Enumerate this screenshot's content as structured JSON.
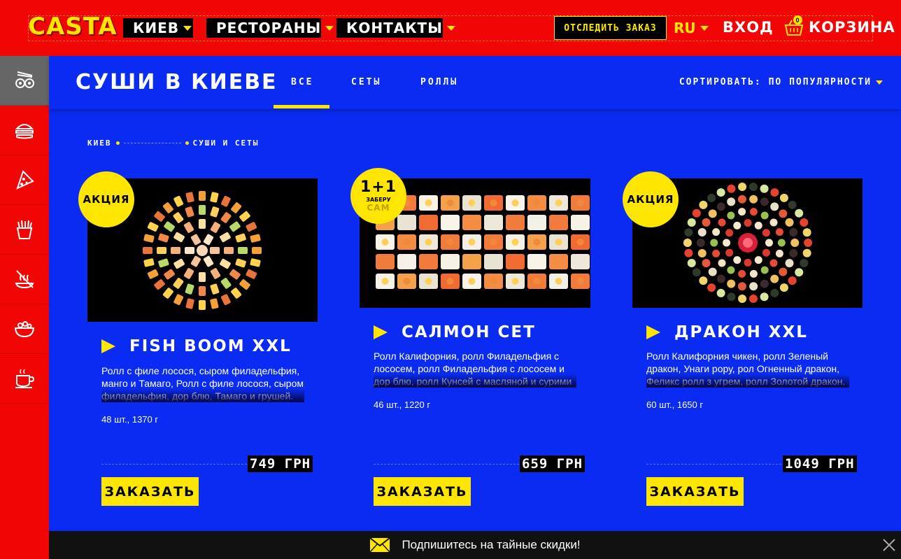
{
  "header": {
    "logo": "CASTA",
    "nav": [
      {
        "label": "КИЕВ"
      },
      {
        "label": "РЕСТОРАНЫ"
      },
      {
        "label": "КОНТАКТЫ"
      }
    ],
    "track_order": "ОТСЛЕДИТЬ ЗАКАЗ",
    "language": "RU",
    "login": "ВХОД",
    "cart_label": "КОРЗИНА",
    "cart_count": "0"
  },
  "sidebar": {
    "items": [
      {
        "icon": "sushi-icon",
        "active": true
      },
      {
        "icon": "burger-icon"
      },
      {
        "icon": "pizza-icon"
      },
      {
        "icon": "fries-icon"
      },
      {
        "icon": "hot-dish-icon"
      },
      {
        "icon": "salad-icon"
      },
      {
        "icon": "coffee-cup-icon"
      }
    ]
  },
  "subheader": {
    "title": "СУШИ В КИЕВЕ",
    "tabs": [
      {
        "label": "ВСЕ",
        "active": true
      },
      {
        "label": "СЕТЫ"
      },
      {
        "label": "РОЛЛЫ"
      }
    ],
    "sort_label": "СОРТИРОВАТЬ: ПО ПОПУЛЯРНОСТИ"
  },
  "breadcrumb": {
    "items": [
      "КИЕВ",
      "СУШИ И СЕТЫ"
    ]
  },
  "products": [
    {
      "badge": "АКЦИЯ",
      "title": "FISH BOOM XXL",
      "description": "Ролл с филе лосося, сыром филадельфия, манго и Тамаго, Ролл с филе лосося, сыром филадельфия, дор блю, Тамаго и грушей.",
      "weight": "48 шт., 1370 г",
      "price": "749 ГРН",
      "order": "ЗАКАЗАТЬ"
    },
    {
      "badge_top": "1+1",
      "badge_small": "ЗАБЕРУ",
      "badge_mid": "САМ",
      "title": "САЛМОН СЕТ",
      "description": "Ролл Калифорния, ролл Филадельфия с лососем, ролл Филадельфия с лососем и дор блю, ролл Кунсей с масляной и сурими",
      "weight": "46 шт., 1220 г",
      "price": "659 ГРН",
      "order": "ЗАКАЗАТЬ"
    },
    {
      "badge": "АКЦИЯ",
      "title": "ДРАКОН XXL",
      "description": "Ролл Калифорния чикен, ролл Зеленый дракон, Унаги рору, рол Огненный дракон, Феликс ролл з угрем, ролл Золотой дракон.",
      "weight": "60 шт., 1650 г",
      "price": "1049 ГРН",
      "order": "ЗАКАЗАТЬ"
    }
  ],
  "subscribe": {
    "text": "Подпишитесь на тайные скидки!"
  },
  "colors": {
    "red": "#f20505",
    "blue": "#0a2cf2",
    "yellow": "#ffe600"
  }
}
